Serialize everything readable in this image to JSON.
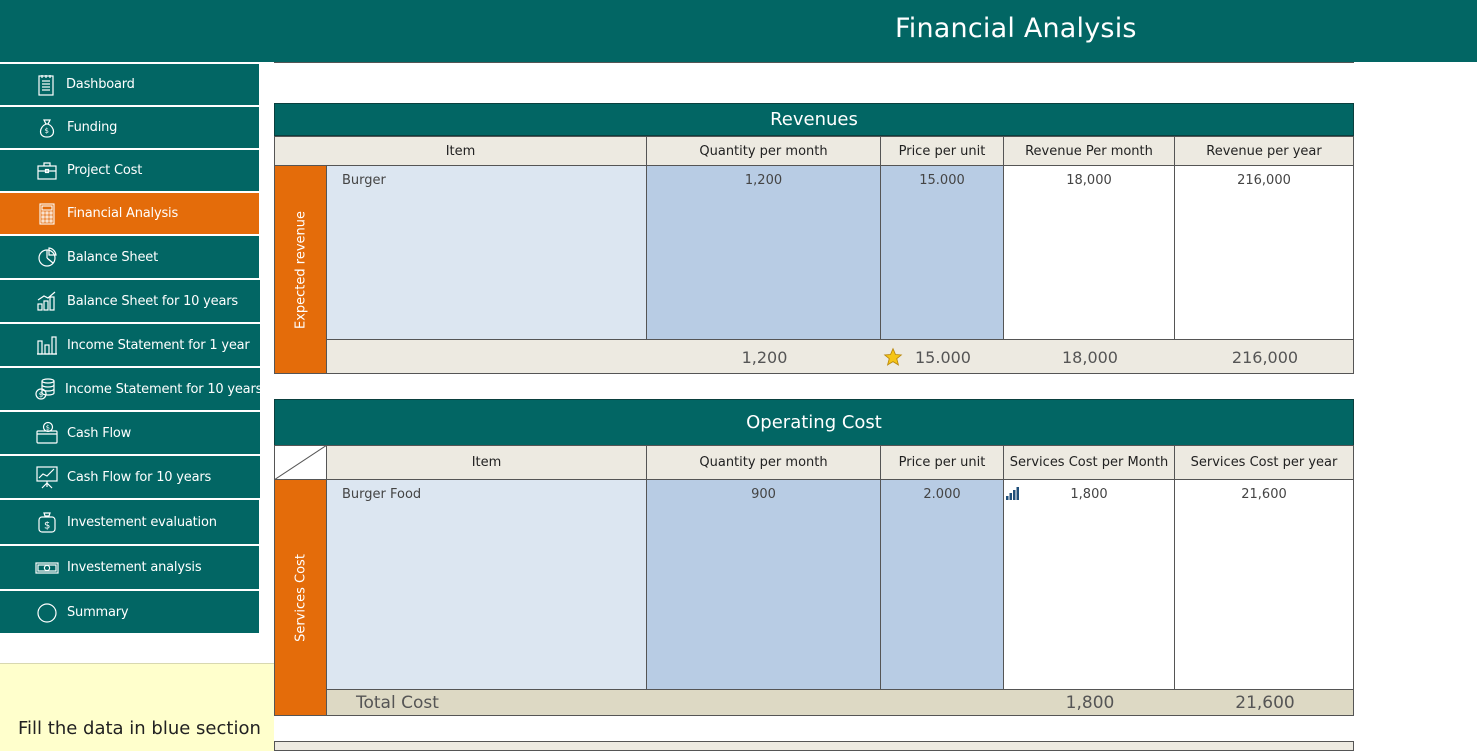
{
  "header": {
    "title": "Financial Analysis"
  },
  "sidebar": {
    "items": [
      {
        "label": "Dashboard",
        "icon": "notepad-icon",
        "active": false
      },
      {
        "label": "Funding",
        "icon": "money-bag-icon",
        "active": false
      },
      {
        "label": "Project Cost",
        "icon": "briefcase-icon",
        "active": false
      },
      {
        "label": "Financial Analysis",
        "icon": "calculator-icon",
        "active": true
      },
      {
        "label": "Balance Sheet",
        "icon": "pie-chart-icon",
        "active": false
      },
      {
        "label": "Balance Sheet for 10 years",
        "icon": "bar-growth-icon",
        "active": false
      },
      {
        "label": "Income Statement for 1 year",
        "icon": "bar-chart-icon",
        "active": false
      },
      {
        "label": "Income Statement for 10 years",
        "icon": "coins-stack-icon",
        "active": false
      },
      {
        "label": "Cash Flow",
        "icon": "wallet-icon",
        "active": false
      },
      {
        "label": "Cash Flow for 10 years",
        "icon": "presentation-chart-icon",
        "active": false
      },
      {
        "label": "Investement evaluation",
        "icon": "dollar-bag-icon",
        "active": false
      },
      {
        "label": "Investement analysis",
        "icon": "banknote-icon",
        "active": false
      },
      {
        "label": "Summary",
        "icon": "circle-icon",
        "active": false
      }
    ],
    "hint": "Fill the data in blue section"
  },
  "revenues": {
    "title": "Revenues",
    "side_label": "Expected revenue",
    "columns": [
      "Item",
      "Quantity per month",
      "Price per unit",
      "Revenue Per month",
      "Revenue per year"
    ],
    "rows": [
      {
        "item": "Burger",
        "qty": "1,200",
        "price": "15.000",
        "rev_month": "18,000",
        "rev_year": "216,000"
      }
    ],
    "totals": {
      "qty": "1,200",
      "price": "15.000",
      "rev_month": "18,000",
      "rev_year": "216,000"
    }
  },
  "operating_cost": {
    "title": "Operating Cost",
    "side_label": "Services Cost",
    "columns": [
      "Item",
      "Quantity per month",
      "Price per unit",
      "Services Cost per Month",
      "Services Cost per year"
    ],
    "rows": [
      {
        "item": "Burger Food",
        "qty": "900",
        "price": "2.000",
        "cost_month": "1,800",
        "cost_year": "21,600"
      }
    ],
    "totals": {
      "label": "Total Cost",
      "cost_month": "1,800",
      "cost_year": "21,600"
    }
  },
  "colors": {
    "teal": "#026664",
    "orange": "#E46C0A",
    "light_blue": "#DCE6F1",
    "mid_blue": "#B8CCE4",
    "beige": "#EDEAE1",
    "hint_yellow": "#FFFFCC"
  }
}
